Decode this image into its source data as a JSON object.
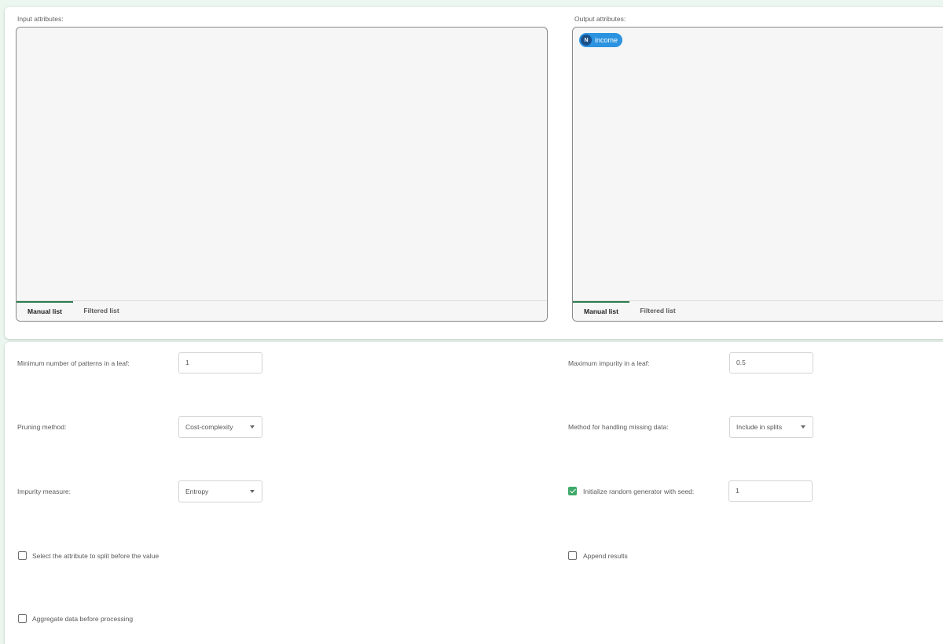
{
  "attributes": {
    "input": {
      "label": "Input attributes:",
      "items": [],
      "tabs": [
        "Manual list",
        "Filtered list"
      ],
      "active_tab": "Manual list"
    },
    "output": {
      "label": "Output attributes:",
      "items": [
        {
          "badge": "N",
          "name": "income"
        }
      ],
      "tabs": [
        "Manual list",
        "Filtered list"
      ],
      "active_tab": "Manual list"
    }
  },
  "params": {
    "min_patterns": {
      "label": "Minimum number of patterns in a leaf:",
      "value": "1"
    },
    "max_impurity": {
      "label": "Maximum impurity in a leaf:",
      "value": "0.5"
    },
    "pruning": {
      "label": "Pruning method:",
      "value": "Cost-complexity"
    },
    "missing_data": {
      "label": "Method for handling missing data:",
      "value": "Include in splits"
    },
    "impurity": {
      "label": "Impurity measure:",
      "value": "Entropy"
    },
    "seed": {
      "label": "Initialize random generator with seed:",
      "checked": true,
      "value": "1"
    },
    "split_attr": {
      "label": "Select the attribute to split before the value",
      "checked": false
    },
    "append": {
      "label": "Append results",
      "checked": false
    },
    "aggregate": {
      "label": "Aggregate data before processing",
      "checked": false
    }
  },
  "colors": {
    "background": "#eaf6ee",
    "chip": "#2b93e0",
    "chip_badge": "#1b4f8a",
    "checkbox_on": "#3ea96a",
    "tab_active": "#2e7d4f"
  }
}
